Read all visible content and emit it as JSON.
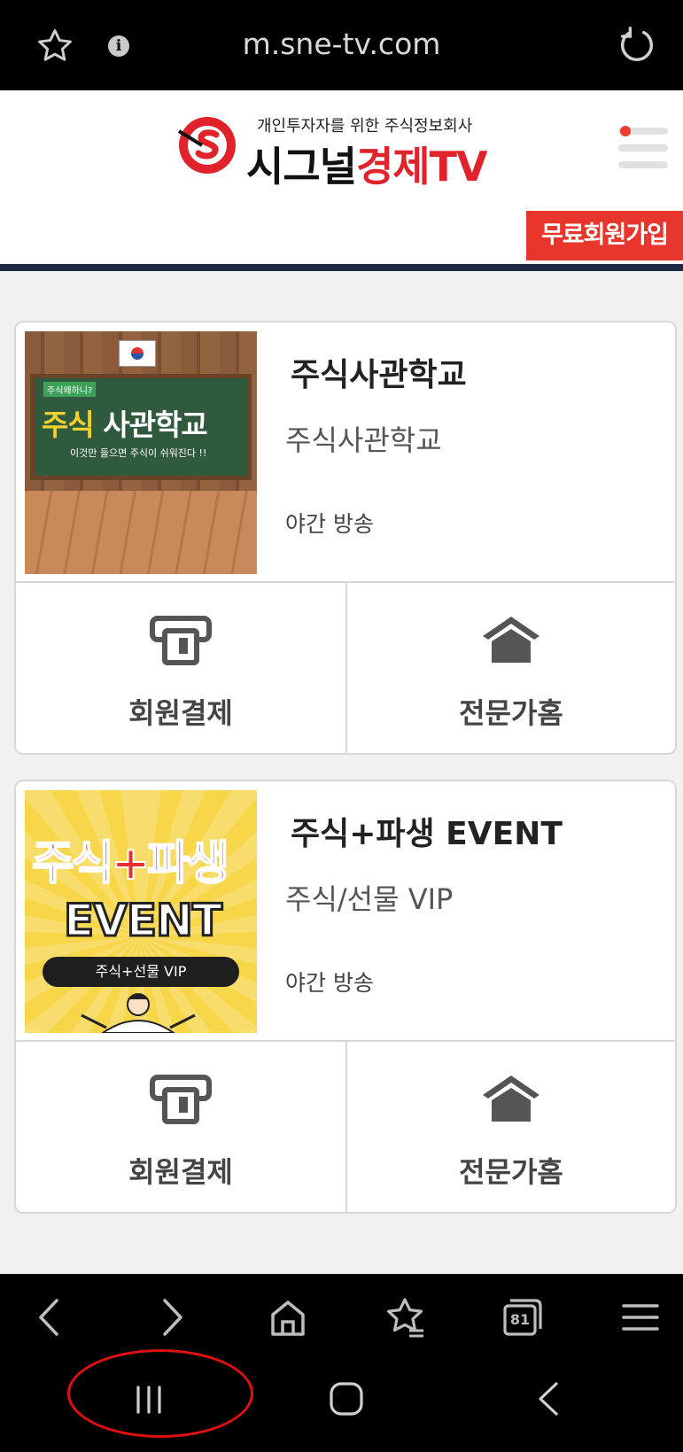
{
  "browser": {
    "url": "m.sne-tv.com",
    "tab_count": "81"
  },
  "site": {
    "tagline": "개인투자자를 위한 주식정보회사",
    "name_part1": "시그널",
    "name_part2": "경제TV",
    "join_button": "무료회원가입"
  },
  "cards": [
    {
      "title": "주식사관학교",
      "subtitle": "주식사관학교",
      "schedule": "야간 방송",
      "thumb": {
        "tag": "주식왜하니?",
        "main_yellow": "주식",
        "main_white": "사관학교",
        "sub": "이것만 들으면 주식이 쉬워진다 !!"
      },
      "actions": [
        {
          "label": "회원결제",
          "icon": "payment-terminal-icon"
        },
        {
          "label": "전문가홈",
          "icon": "home-icon"
        }
      ]
    },
    {
      "title": "주식+파생 EVENT",
      "subtitle": "주식/선물 VIP",
      "schedule": "야간 방송",
      "thumb": {
        "main_red": "주식",
        "main_plus": "+",
        "main_purple": "파생",
        "event": "EVENT",
        "pill": "주식+선물 VIP"
      },
      "actions": [
        {
          "label": "회원결제",
          "icon": "payment-terminal-icon"
        },
        {
          "label": "전문가홈",
          "icon": "home-icon"
        }
      ]
    }
  ],
  "colors": {
    "brand_red": "#e0232b",
    "join_bg": "#e8362c",
    "header_rule": "#1c2a43",
    "annotation": "#e01010"
  }
}
